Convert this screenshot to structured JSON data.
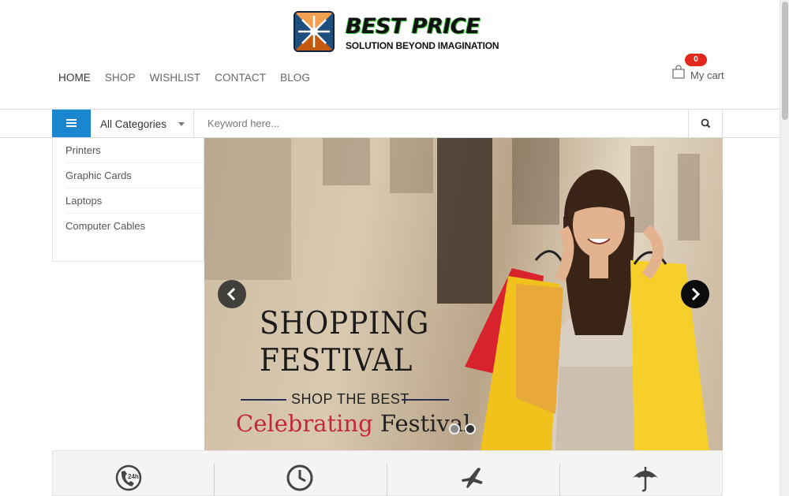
{
  "brand": {
    "name": "BEST PRICE",
    "tagline": "SOLUTION BEYOND IMAGINATION"
  },
  "nav": {
    "items": [
      {
        "label": "HOME",
        "active": true
      },
      {
        "label": "SHOP",
        "active": false
      },
      {
        "label": "WISHLIST",
        "active": false
      },
      {
        "label": "CONTACT",
        "active": false
      },
      {
        "label": "BLOG",
        "active": false
      }
    ]
  },
  "cart": {
    "count": "0",
    "label": "My cart"
  },
  "search": {
    "category_selected": "All Categories",
    "placeholder": "Keyword here...",
    "value": ""
  },
  "categories": [
    {
      "label": "Printers"
    },
    {
      "label": "Graphic Cards"
    },
    {
      "label": "Laptops"
    },
    {
      "label": "Computer Cables"
    }
  ],
  "slider": {
    "title_line1": "SHOPPING",
    "title_line2": "FESTIVAL",
    "subtitle": "SHOP THE BEST",
    "caption_part1": "Celebrating",
    "caption_part2": "Festival",
    "slides_total": 2,
    "active_slide": 2
  },
  "features": {
    "icons": [
      "phone-24h-icon",
      "clock-icon",
      "airplane-icon",
      "umbrella-icon"
    ]
  },
  "colors": {
    "accent": "#1a86d0",
    "badge": "#e0281c",
    "caption_red": "#c4273d"
  }
}
